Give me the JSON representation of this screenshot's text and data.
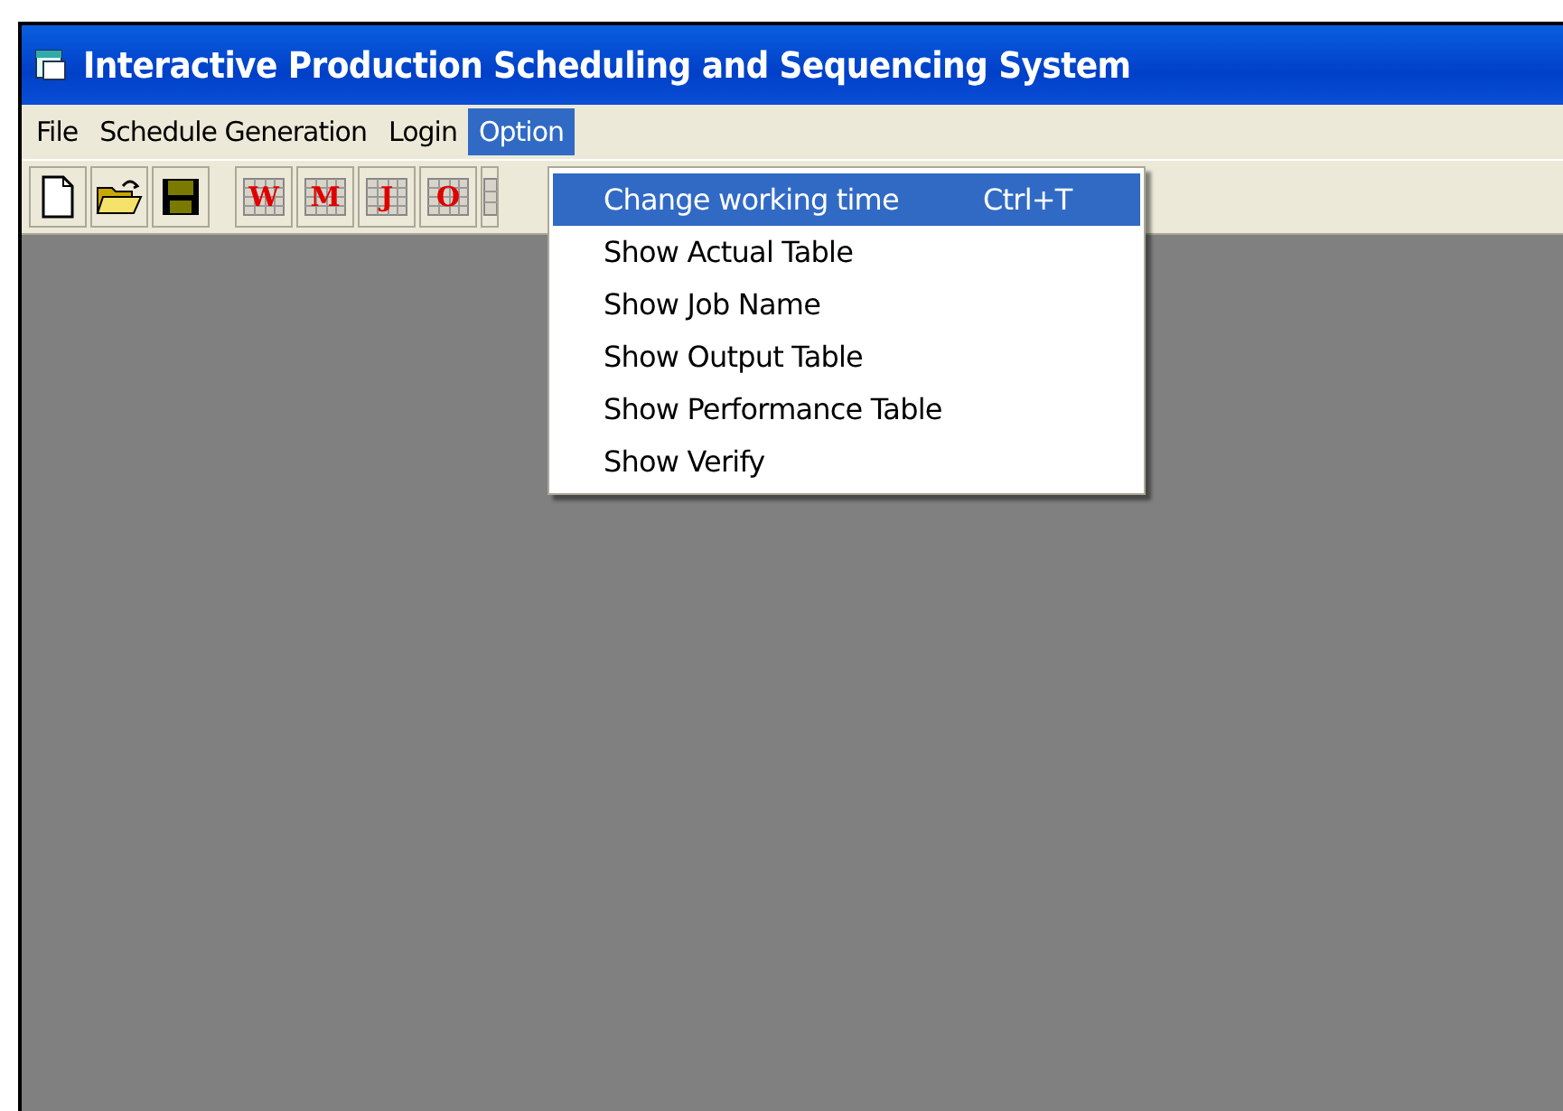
{
  "window": {
    "title": "Interactive Production Scheduling and Sequencing System"
  },
  "menu_bar": [
    {
      "label": "File",
      "selected": false
    },
    {
      "label": "Schedule Generation",
      "selected": false
    },
    {
      "label": "Login",
      "selected": false
    },
    {
      "label": "Option",
      "selected": true
    }
  ],
  "toolbar": [
    {
      "kind": "new"
    },
    {
      "kind": "open"
    },
    {
      "kind": "save"
    },
    {
      "kind": "separator"
    },
    {
      "kind": "grid",
      "letter": "W"
    },
    {
      "kind": "grid",
      "letter": "M"
    },
    {
      "kind": "grid",
      "letter": "J"
    },
    {
      "kind": "grid",
      "letter": "O"
    },
    {
      "kind": "grid_plain"
    }
  ],
  "option_menu": [
    {
      "label": "Change working time",
      "shortcut": "Ctrl+T",
      "selected": true
    },
    {
      "label": "Show Actual Table",
      "selected": false
    },
    {
      "label": "Show Job Name",
      "selected": false
    },
    {
      "label": "Show Output Table",
      "selected": false
    },
    {
      "label": "Show Performance Table",
      "selected": false
    },
    {
      "label": "Show Verify",
      "selected": false
    }
  ]
}
